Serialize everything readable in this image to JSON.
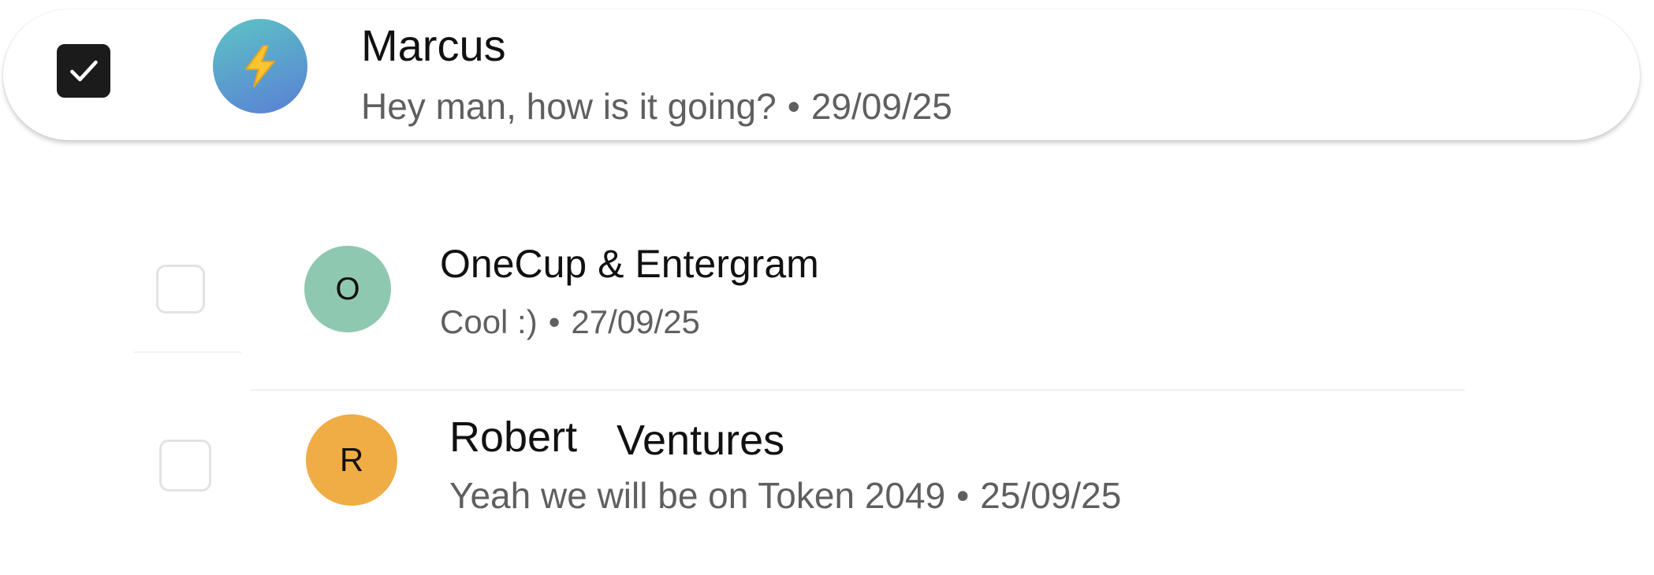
{
  "conversations": [
    {
      "name": "Marcus",
      "preview": "Hey man, how is it going?",
      "date": "29/09/25",
      "separator": "•",
      "selected": true,
      "avatar_icon": "lightning-bolt-icon",
      "avatar_colors": [
        "#5cc4c4",
        "#5a7fd6"
      ]
    },
    {
      "name": "OneCup & Entergram",
      "preview": "Cool :)",
      "date": "27/09/25",
      "separator": "•",
      "selected": false,
      "avatar_letter": "O",
      "avatar_color": "#8fc8b0"
    },
    {
      "name_part1": "Robert",
      "name_part2": "Ventures",
      "preview": "Yeah we will be on Token 2049",
      "date": "25/09/25",
      "separator": "•",
      "selected": false,
      "avatar_letter": "R",
      "avatar_color": "#f0ad45"
    }
  ],
  "colors": {
    "checkbox_checked": "#1b1b1b",
    "checkbox_border": "#e3e3e3",
    "name_text": "#111111",
    "meta_text": "#5f5f5f"
  }
}
